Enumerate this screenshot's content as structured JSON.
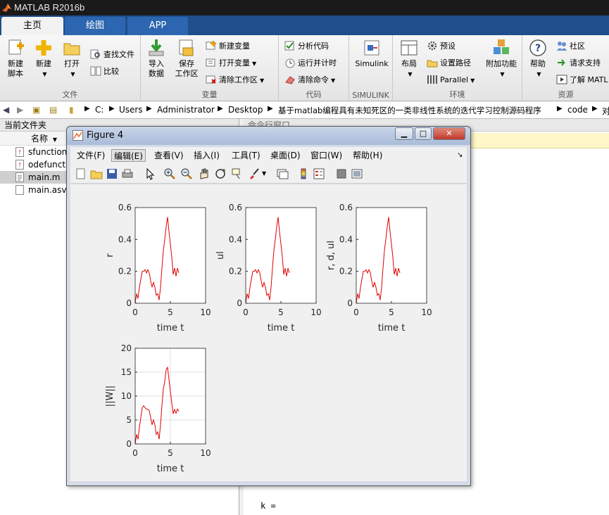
{
  "app": {
    "title": "MATLAB R2016b"
  },
  "tabs": [
    {
      "label": "主页",
      "active": true
    },
    {
      "label": "绘图",
      "active": false
    },
    {
      "label": "APP",
      "active": false
    }
  ],
  "ribbon": {
    "file": {
      "label": "文件",
      "new_script": [
        "新建",
        "脚本"
      ],
      "new": "新建",
      "open": "打开",
      "find_files": "查找文件",
      "compare": "比较"
    },
    "variable": {
      "label": "变量",
      "import": [
        "导入",
        "数据"
      ],
      "save_ws": [
        "保存",
        "工作区"
      ],
      "new_var": "新建变量",
      "open_var": "打开变量",
      "clear_ws": "清除工作区"
    },
    "code": {
      "label": "代码",
      "analyze": "分析代码",
      "run_time": "运行并计时",
      "clear_cmd": "清除命令"
    },
    "simulink": {
      "label": "SIMULINK",
      "btn": "Simulink"
    },
    "env": {
      "label": "环境",
      "layout": "布局",
      "prefs": "预设",
      "set_path": "设置路径",
      "parallel": "Parallel",
      "addons": "附加功能"
    },
    "resources": {
      "label": "资源",
      "help": "帮助",
      "community": "社区",
      "support": "请求支持",
      "learn": "了解 MATL"
    }
  },
  "address": {
    "segments": [
      "C:",
      "Users",
      "Administrator",
      "Desktop",
      "基于matlab编程具有未知死区的一类非线性系统的迭代学习控制源码程序",
      "code",
      "对"
    ]
  },
  "current_folder": {
    "title": "当前文件夹",
    "column": "名称",
    "files": [
      {
        "name": "sfunction",
        "type": "mfunc",
        "selected": false
      },
      {
        "name": "odefunct",
        "type": "mfunc",
        "selected": false
      },
      {
        "name": "main.m",
        "type": "script",
        "selected": true
      },
      {
        "name": "main.asv",
        "type": "asv",
        "selected": false
      }
    ]
  },
  "command_window": {
    "title": "命令行窗口",
    "text": "k ="
  },
  "figure": {
    "title": "Figure 4",
    "menu": [
      "文件(F)",
      "编辑(E)",
      "查看(V)",
      "插入(I)",
      "工具(T)",
      "桌面(D)",
      "窗口(W)",
      "帮助(H)"
    ],
    "active_menu": 1,
    "toolbar_icons": [
      "new-figure-icon",
      "open-icon",
      "save-icon",
      "print-icon",
      "pointer-icon",
      "zoom-in-icon",
      "zoom-out-icon",
      "pan-icon",
      "rotate-icon",
      "data-cursor-icon",
      "brush-icon",
      "link-icon",
      "colorbar-icon",
      "legend-icon",
      "hide-plot-tools-icon",
      "show-plot-tools-icon"
    ]
  },
  "chart_data": [
    {
      "type": "line",
      "xlabel": "time t",
      "ylabel": "r",
      "xlim": [
        0,
        10
      ],
      "ylim": [
        0,
        0.6
      ],
      "xticks": [
        "0",
        "5",
        "10"
      ],
      "yticks": [
        "0",
        "0.2",
        "0.4",
        "0.6"
      ],
      "grid": false,
      "color": "#e00000",
      "series": [
        {
          "x": [
            0,
            0.2,
            0.4,
            0.6,
            0.8,
            1.0,
            1.2,
            1.4,
            1.6,
            1.8,
            2.0,
            2.2,
            2.4,
            2.6,
            2.8,
            3.0,
            3.2,
            3.4,
            3.6,
            3.8,
            4.0,
            4.2,
            4.4,
            4.6,
            4.8,
            5.0,
            5.2,
            5.4,
            5.6,
            5.8,
            6.0,
            6.2
          ],
          "y": [
            0.0,
            0.06,
            0.03,
            0.1,
            0.15,
            0.2,
            0.2,
            0.21,
            0.19,
            0.21,
            0.19,
            0.14,
            0.1,
            0.13,
            0.1,
            0.05,
            0.06,
            0.02,
            0.1,
            0.22,
            0.33,
            0.4,
            0.48,
            0.54,
            0.45,
            0.37,
            0.29,
            0.18,
            0.22,
            0.17,
            0.22,
            0.19
          ]
        }
      ]
    },
    {
      "type": "line",
      "xlabel": "time t",
      "ylabel": "ul",
      "xlim": [
        0,
        10
      ],
      "ylim": [
        0,
        0.6
      ],
      "xticks": [
        "0",
        "5",
        "10"
      ],
      "yticks": [
        "0",
        "0.2",
        "0.4",
        "0.6"
      ],
      "grid": false,
      "color": "#e00000",
      "series": [
        {
          "x": [
            0,
            0.2,
            0.4,
            0.6,
            0.8,
            1.0,
            1.2,
            1.4,
            1.6,
            1.8,
            2.0,
            2.2,
            2.4,
            2.6,
            2.8,
            3.0,
            3.2,
            3.4,
            3.6,
            3.8,
            4.0,
            4.2,
            4.4,
            4.6,
            4.8,
            5.0,
            5.2,
            5.4,
            5.6,
            5.8,
            6.0,
            6.2
          ],
          "y": [
            0.0,
            0.06,
            0.03,
            0.1,
            0.15,
            0.2,
            0.2,
            0.21,
            0.19,
            0.21,
            0.19,
            0.14,
            0.1,
            0.13,
            0.1,
            0.05,
            0.06,
            0.02,
            0.1,
            0.22,
            0.33,
            0.4,
            0.48,
            0.54,
            0.45,
            0.37,
            0.29,
            0.18,
            0.22,
            0.17,
            0.22,
            0.19
          ]
        }
      ]
    },
    {
      "type": "line",
      "xlabel": "time t",
      "ylabel": "r, d, ul",
      "xlim": [
        0,
        10
      ],
      "ylim": [
        0,
        0.6
      ],
      "xticks": [
        "0",
        "5",
        "10"
      ],
      "yticks": [
        "0",
        "0.2",
        "0.4",
        "0.6"
      ],
      "grid": false,
      "color": "#e00000",
      "series": [
        {
          "x": [
            0,
            0.2,
            0.4,
            0.6,
            0.8,
            1.0,
            1.2,
            1.4,
            1.6,
            1.8,
            2.0,
            2.2,
            2.4,
            2.6,
            2.8,
            3.0,
            3.2,
            3.4,
            3.6,
            3.8,
            4.0,
            4.2,
            4.4,
            4.6,
            4.8,
            5.0,
            5.2,
            5.4,
            5.6,
            5.8,
            6.0,
            6.2
          ],
          "y": [
            0.0,
            0.06,
            0.03,
            0.1,
            0.15,
            0.2,
            0.2,
            0.21,
            0.19,
            0.21,
            0.19,
            0.14,
            0.1,
            0.13,
            0.1,
            0.05,
            0.06,
            0.02,
            0.1,
            0.22,
            0.33,
            0.4,
            0.48,
            0.54,
            0.45,
            0.37,
            0.29,
            0.18,
            0.22,
            0.17,
            0.22,
            0.19
          ]
        }
      ]
    },
    {
      "type": "line",
      "xlabel": "time t",
      "ylabel": "||W||",
      "xlim": [
        0,
        10
      ],
      "ylim": [
        0,
        20
      ],
      "xticks": [
        "0",
        "5",
        "10"
      ],
      "yticks": [
        "0",
        "5",
        "10",
        "15",
        "20"
      ],
      "grid": true,
      "color": "#e00000",
      "series": [
        {
          "x": [
            0,
            0.2,
            0.4,
            0.6,
            0.8,
            1.0,
            1.2,
            1.4,
            1.6,
            1.8,
            2.0,
            2.2,
            2.4,
            2.6,
            2.8,
            3.0,
            3.2,
            3.4,
            3.6,
            3.8,
            4.0,
            4.2,
            4.4,
            4.6,
            4.8,
            5.0,
            5.2,
            5.4,
            5.6,
            5.8,
            6.0,
            6.2
          ],
          "y": [
            0.0,
            2.0,
            1.0,
            3.5,
            5.5,
            7.5,
            8.0,
            7.6,
            7.3,
            7.2,
            7.0,
            5.5,
            4.0,
            5.0,
            4.0,
            2.0,
            2.5,
            1.0,
            4.0,
            8.0,
            11.5,
            13.0,
            15.5,
            16.0,
            13.5,
            11.0,
            8.5,
            6.3,
            7.2,
            6.4,
            7.3,
            6.8
          ]
        }
      ]
    }
  ]
}
